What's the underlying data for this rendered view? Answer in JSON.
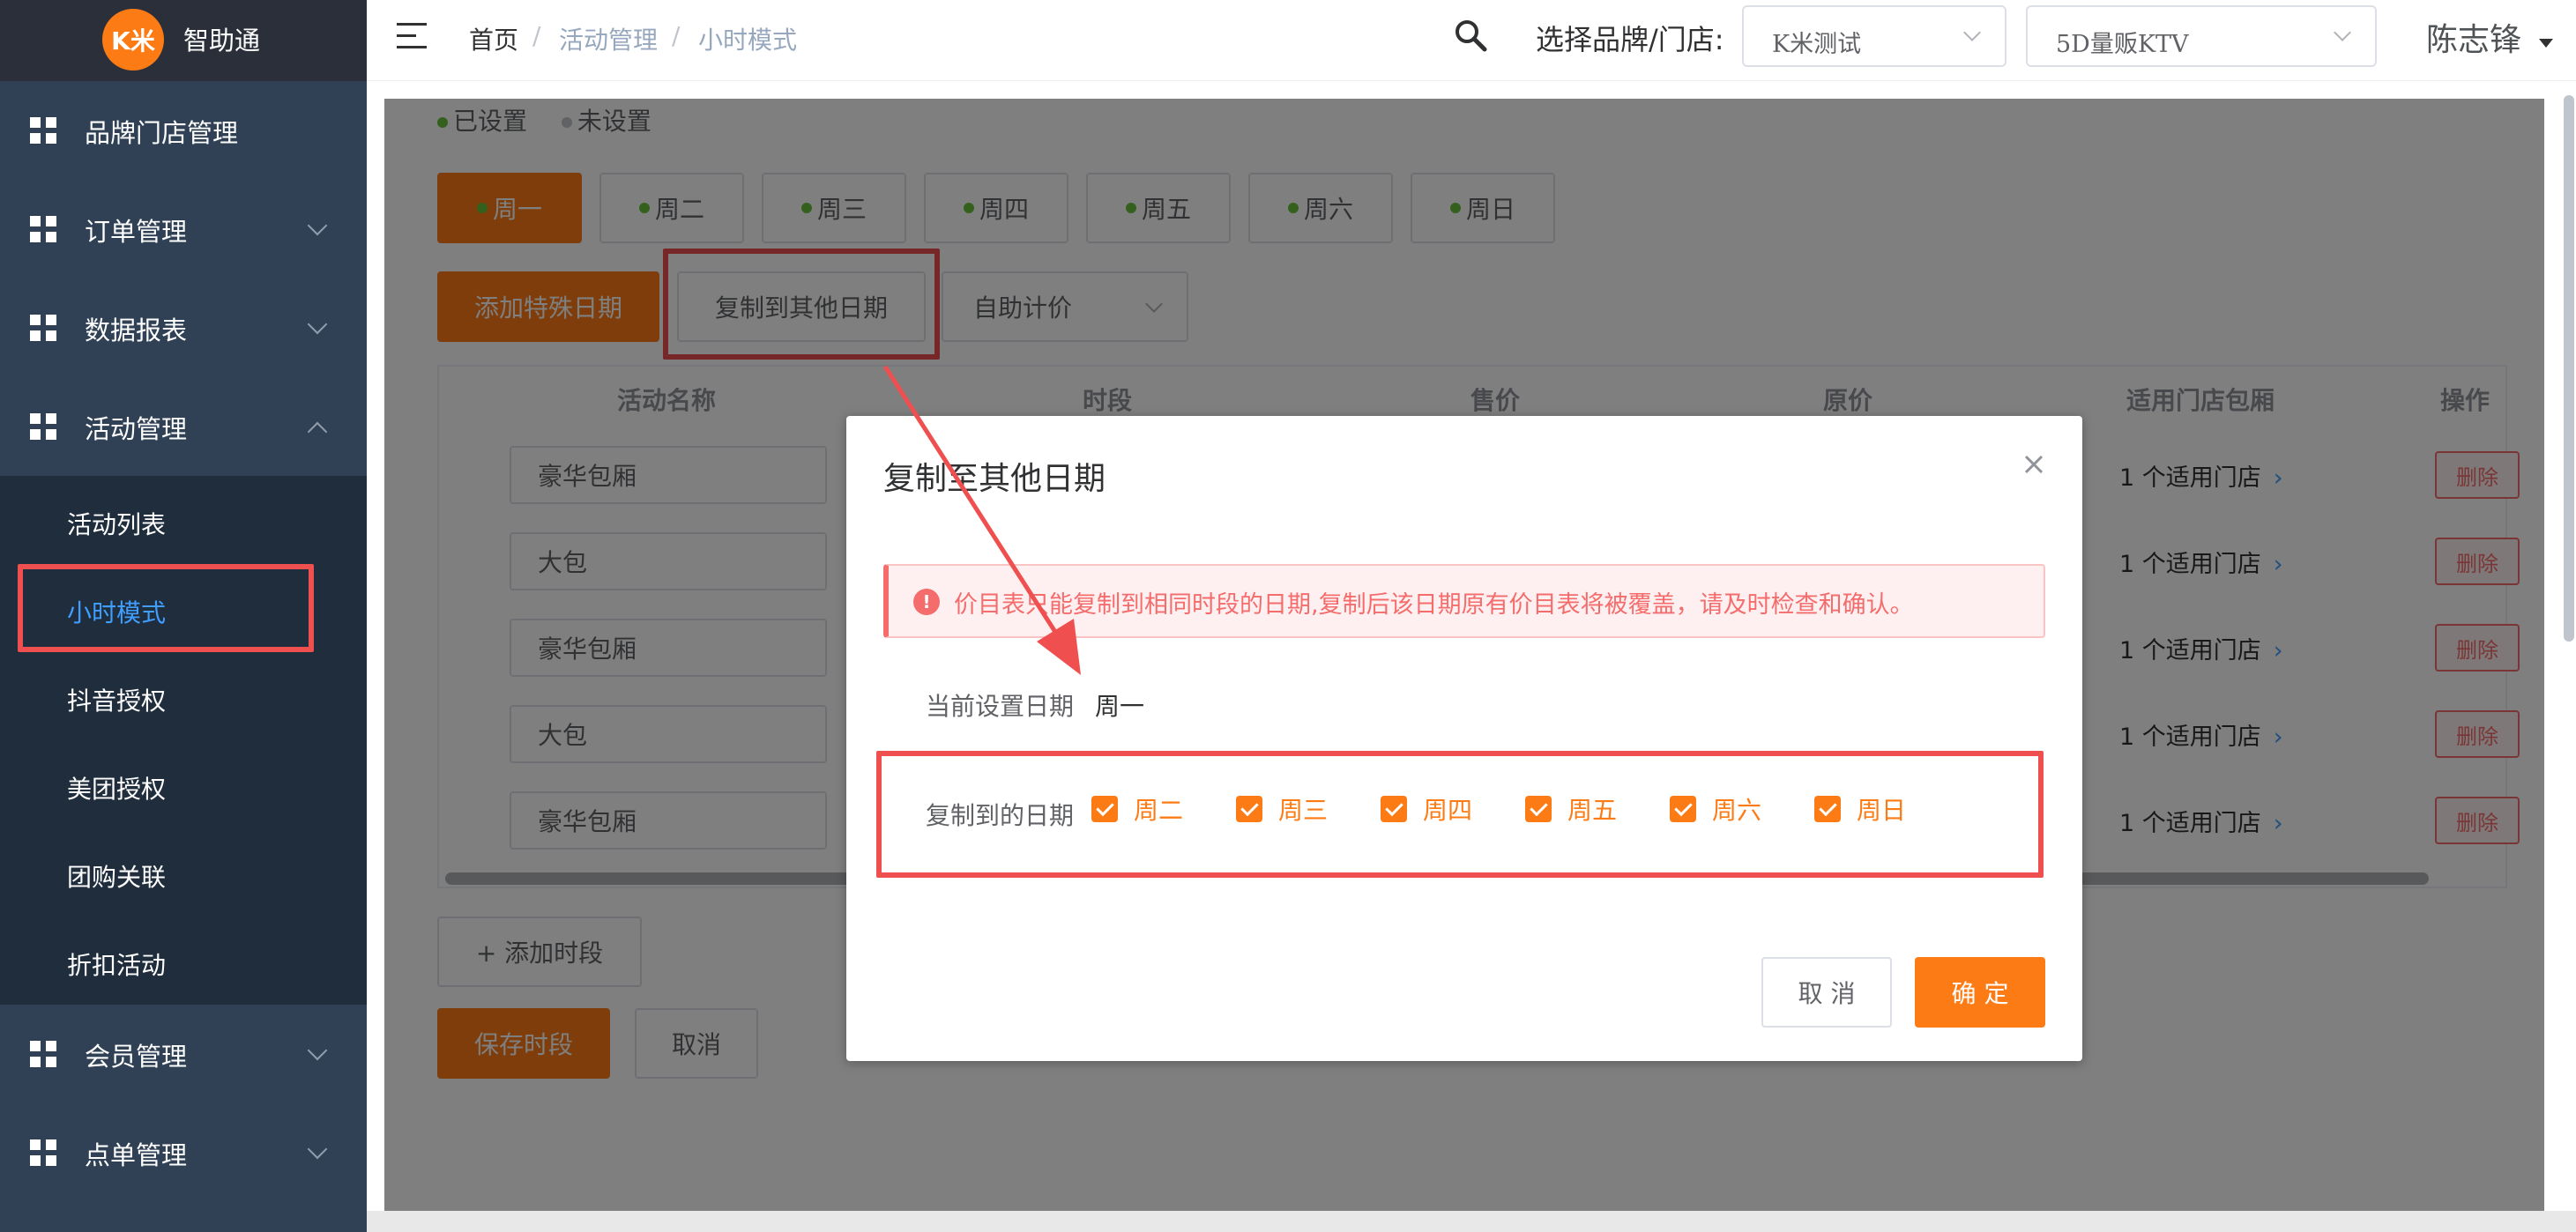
{
  "app": {
    "logo_badge": "K米",
    "name": "智助通"
  },
  "sidebar": {
    "menus": [
      {
        "label": "品牌门店管理"
      },
      {
        "label": "订单管理"
      },
      {
        "label": "数据报表"
      },
      {
        "label": "活动管理"
      },
      {
        "label": "会员管理"
      },
      {
        "label": "点单管理"
      }
    ],
    "activity_submenu": [
      {
        "label": "活动列表"
      },
      {
        "label": "小时模式"
      },
      {
        "label": "抖音授权"
      },
      {
        "label": "美团授权"
      },
      {
        "label": "团购关联"
      },
      {
        "label": "折扣活动"
      }
    ],
    "active_submenu": "小时模式"
  },
  "header": {
    "breadcrumb": [
      "首页",
      "活动管理",
      "小时模式"
    ],
    "breadcrumb_sep": "/",
    "store_label": "选择品牌/门店:",
    "brand_value": "K米测试",
    "store_value": "5D量贩KTV",
    "user": "陈志锋"
  },
  "legend": {
    "set": "已设置",
    "unset": "未设置"
  },
  "days": [
    "周一",
    "周二",
    "周三",
    "周四",
    "周五",
    "周六",
    "周日"
  ],
  "active_day": "周一",
  "toolbar": {
    "add_special": "添加特殊日期",
    "copy_other": "复制到其他日期",
    "pricing_mode": "自助计价"
  },
  "table": {
    "columns": [
      "活动名称",
      "时段",
      "售价",
      "原价",
      "适用门店包厢",
      "操作"
    ],
    "rows": [
      {
        "name": "豪华包厢",
        "stores": "1 个适用门店",
        "action": "删除"
      },
      {
        "name": "大包",
        "stores": "1 个适用门店",
        "action": "删除"
      },
      {
        "name": "豪华包厢",
        "stores": "1 个适用门店",
        "action": "删除"
      },
      {
        "name": "大包",
        "stores": "1 个适用门店",
        "action": "删除"
      },
      {
        "name": "豪华包厢",
        "stores": "1 个适用门店",
        "action": "删除"
      }
    ],
    "stores_arrow": "›"
  },
  "bottom_actions": {
    "add_slot": "+ 添加时段",
    "save_slot": "保存时段",
    "cancel": "取消"
  },
  "dialog": {
    "title": "复制至其他日期",
    "alert": "价目表只能复制到相同时段的日期,复制后该日期原有价目表将被覆盖，请及时检查和确认。",
    "alert_icon": "!",
    "current_label": "当前设置日期",
    "current_value": "周一",
    "copy_label": "复制到的日期",
    "options": [
      {
        "label": "周二",
        "checked": true
      },
      {
        "label": "周三",
        "checked": true
      },
      {
        "label": "周四",
        "checked": true
      },
      {
        "label": "周五",
        "checked": true
      },
      {
        "label": "周六",
        "checked": true
      },
      {
        "label": "周日",
        "checked": true
      }
    ],
    "cancel": "取 消",
    "confirm": "确 定"
  },
  "colors": {
    "accent": "#fd7b14",
    "sidebar": "#304156",
    "highlight": "#ef4f4f",
    "link": "#409eff",
    "set_dot": "#67c23a",
    "unset_dot": "#c0c4cc"
  }
}
